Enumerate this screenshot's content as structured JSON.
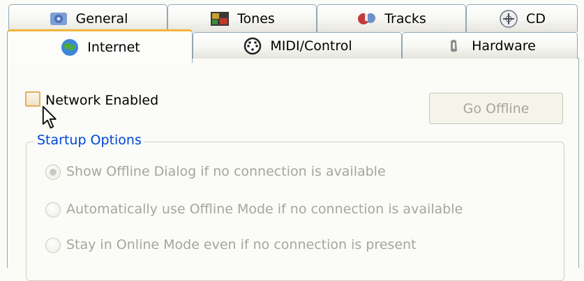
{
  "tabs_row1": [
    {
      "label": "General",
      "icon": "general-settings-icon"
    },
    {
      "label": "Tones",
      "icon": "tones-icon"
    },
    {
      "label": "Tracks",
      "icon": "tracks-icon"
    },
    {
      "label": "CD",
      "icon": "cd-icon"
    }
  ],
  "tabs_row2": [
    {
      "label": "Internet",
      "icon": "globe-icon",
      "active": true
    },
    {
      "label": "MIDI/Control",
      "icon": "midi-connector-icon"
    },
    {
      "label": "Hardware",
      "icon": "hardware-icon"
    }
  ],
  "network": {
    "label": "Network Enabled",
    "checked": false
  },
  "go_offline": {
    "label": "Go Offline",
    "enabled": false
  },
  "startup": {
    "title": "Startup Options",
    "options": [
      {
        "label": "Show Offline Dialog if no connection is available",
        "selected": true
      },
      {
        "label": "Automatically use Offline Mode if no connection is available",
        "selected": false
      },
      {
        "label": "Stay in Online Mode even if no connection is present",
        "selected": false
      }
    ]
  },
  "colors": {
    "active_tab_accent": "#f0b539",
    "group_title": "#0046d5",
    "disabled_text": "#a6a69c"
  }
}
